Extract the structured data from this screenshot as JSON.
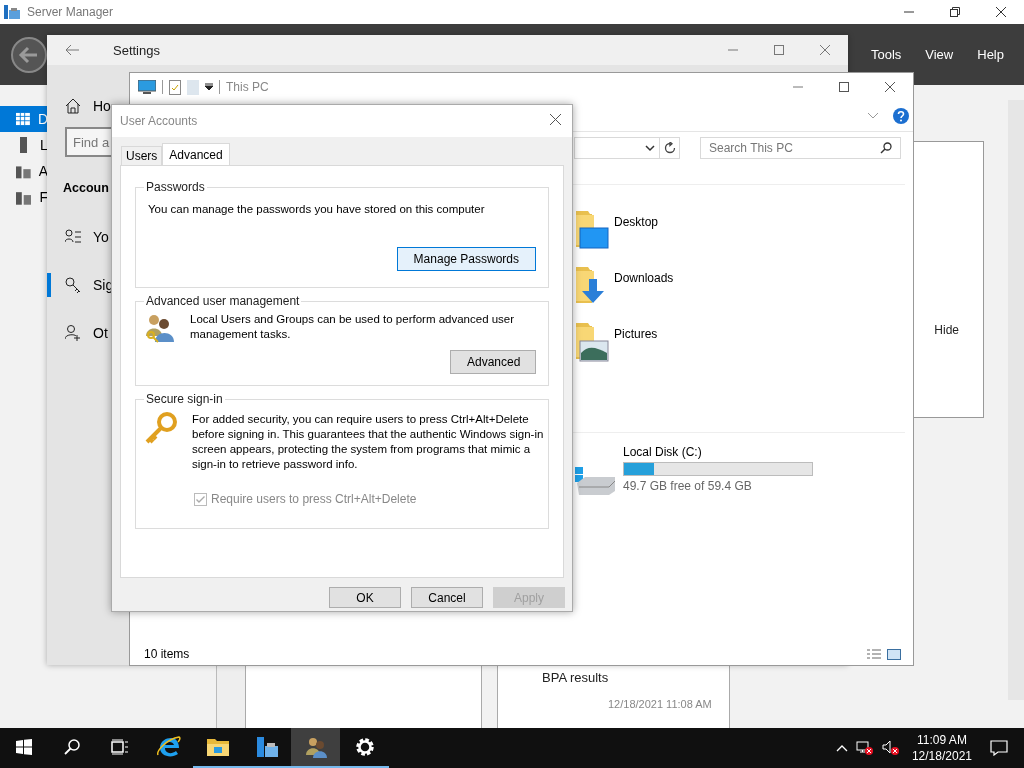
{
  "server_manager": {
    "title": "Server Manager",
    "menu": [
      {
        "label": "Tools"
      },
      {
        "label": "View"
      },
      {
        "label": "Help"
      }
    ],
    "nav": [
      {
        "kind": "dashboard",
        "label": "D",
        "selected": true
      },
      {
        "kind": "local",
        "label": "L",
        "selected": false
      },
      {
        "kind": "all",
        "label": "A",
        "selected": false
      },
      {
        "kind": "files",
        "label": "F",
        "selected": false
      }
    ],
    "panel_button": "Hide",
    "tile_title": "BPA results",
    "tile_time": "12/18/2021 11:08 AM"
  },
  "settings": {
    "title": "Settings",
    "home": "Ho",
    "search_placeholder": "Find a",
    "section": "Accoun",
    "items": [
      {
        "kind": "info",
        "label": "Yo",
        "selected": false
      },
      {
        "kind": "signin",
        "label": "Sig",
        "selected": true
      },
      {
        "kind": "other",
        "label": "Ot",
        "selected": false
      }
    ]
  },
  "explorer": {
    "title": "This PC",
    "search_placeholder": "Search This PC",
    "folders": [
      {
        "kind": "desktop",
        "name": "Desktop"
      },
      {
        "kind": "downloads",
        "name": "Downloads"
      },
      {
        "kind": "pictures",
        "name": "Pictures"
      }
    ],
    "drives": [
      {
        "name": "Local Disk (C:)",
        "level": 0.16,
        "free": "49.7 GB free of 59.4 GB"
      }
    ],
    "status": "10 items"
  },
  "dialog": {
    "title": "User Accounts",
    "tabs": [
      {
        "label": "Users",
        "selected": false
      },
      {
        "label": "Advanced",
        "selected": true
      }
    ],
    "groups": [
      {
        "kind": "passwords",
        "title": "Passwords",
        "text": "You can manage the passwords you have stored on this computer",
        "button": "Manage Passwords",
        "hovered": true
      },
      {
        "kind": "users",
        "title": "Advanced user management",
        "text": "Local Users and Groups can be used to perform advanced user management tasks.",
        "button": "Advanced",
        "hovered": false
      },
      {
        "kind": "secure",
        "title": "Secure sign-in",
        "text": "For added security, you can require users to press Ctrl+Alt+Delete before signing in. This guarantees that the authentic Windows sign-in screen appears, protecting the system from programs that mimic a sign-in to retrieve password info.",
        "checkbox": {
          "label": "Require users to press Ctrl+Alt+Delete",
          "checked": true,
          "disabled": true
        }
      }
    ],
    "buttons": [
      {
        "label": "OK",
        "disabled": false
      },
      {
        "label": "Cancel",
        "disabled": false
      },
      {
        "label": "Apply",
        "disabled": true
      }
    ]
  },
  "taskbar": {
    "apps": [
      {
        "kind": "ie",
        "running": false,
        "active": false
      },
      {
        "kind": "explorer",
        "running": true,
        "active": false
      },
      {
        "kind": "server",
        "running": true,
        "active": false
      },
      {
        "kind": "users",
        "running": true,
        "active": true
      },
      {
        "kind": "settings",
        "running": true,
        "active": false
      }
    ],
    "time": "11:09 AM",
    "date": "12/18/2021"
  }
}
